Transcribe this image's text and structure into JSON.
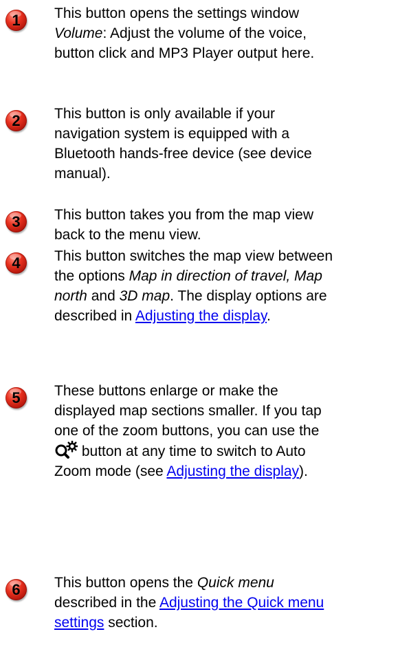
{
  "items": [
    {
      "number": "1",
      "line_1": "This button opens the settings window",
      "volume_label": "Volume",
      "line_2_rest": ": Adjust the volume of the voice,",
      "line_3": "button click and MP3 Player output here."
    },
    {
      "number": "2",
      "line_1": "This button is only available if your",
      "line_2": "navigation system is equipped with a",
      "line_3": "Bluetooth hands-free device (see device",
      "line_4": "manual)."
    },
    {
      "number": "3",
      "line_1": "This button takes you from the map view",
      "line_2": "back to the menu view."
    },
    {
      "number": "4",
      "line_1": "This button switches the map view between",
      "line_2_pre": "the options ",
      "option_1": "Map in direction of travel, Map",
      "line_3_option": "north",
      "line_3_and": " and ",
      "option_3": "3D map",
      "line_3_rest": ". The display options are",
      "line_4_pre": "described in ",
      "link_text": "Adjusting the display",
      "line_4_end": "."
    },
    {
      "number": "5",
      "line_1": "These buttons enlarge or make the",
      "line_2": "displayed map sections smaller. If you tap",
      "line_3": "one of the zoom buttons, you can use the",
      "icon": "auto-zoom-icon",
      "line_4_rest": " button at any time to switch to Auto",
      "line_5_pre": "Zoom mode (see ",
      "link_text": "Adjusting the display",
      "line_5_end": ")."
    },
    {
      "number": "6",
      "line_1_pre": "This button opens the ",
      "quick_menu_label": "Quick menu",
      "line_2_pre": "described in the ",
      "link_text_1": "Adjusting the Quick menu",
      "link_text_2": "settings",
      "line_3_end": " section."
    }
  ],
  "colors": {
    "badge": "#d9261a",
    "link": "#0000ee",
    "text": "#000000"
  }
}
